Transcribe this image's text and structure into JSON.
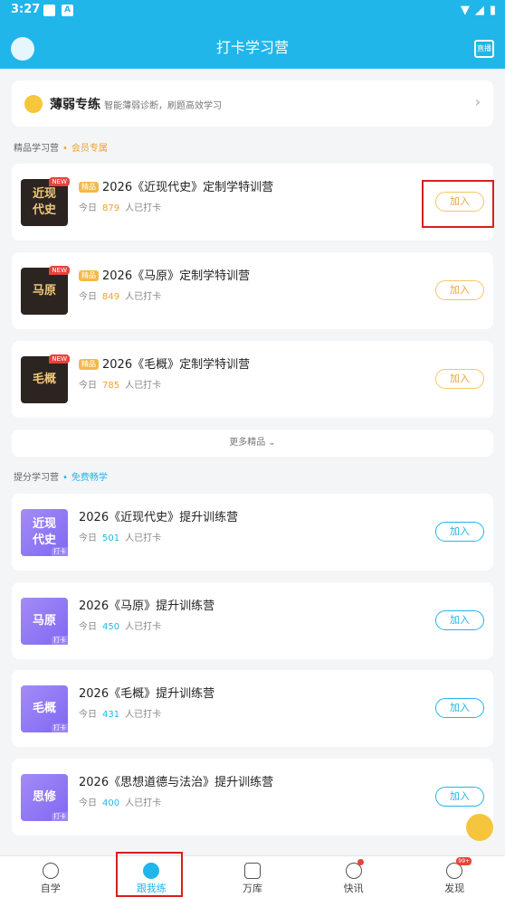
{
  "status_bar": {
    "time": "3:27"
  },
  "header": {
    "title": "打卡学习营",
    "live_label": "直播"
  },
  "weak_practice": {
    "title": "薄弱专练",
    "subtitle": "智能薄弱诊断，刷题高效学习"
  },
  "premium_section": {
    "label": "精品学习营",
    "tag": "会员专属",
    "badge": "精品",
    "new_tag": "NEW",
    "today_prefix": "今日",
    "today_suffix": "人已打卡",
    "join_label": "加入"
  },
  "premium_camps": [
    {
      "thumb": "近现代史",
      "name": "2026《近现代史》定制学特训营",
      "count": "879"
    },
    {
      "thumb": "马原",
      "name": "2026《马原》定制学特训营",
      "count": "849"
    },
    {
      "thumb": "毛概",
      "name": "2026《毛概》定制学特训营",
      "count": "785"
    }
  ],
  "more_premium": "更多精品",
  "boost_section": {
    "label": "提分学习营",
    "tag": "免费畅学",
    "thumb_tag": "打卡",
    "today_prefix": "今日",
    "today_suffix": "人已打卡",
    "join_label": "加入"
  },
  "boost_camps": [
    {
      "thumb": "近现代史",
      "name": "2026《近现代史》提升训练营",
      "count": "501"
    },
    {
      "thumb": "马原",
      "name": "2026《马原》提升训练营",
      "count": "450"
    },
    {
      "thumb": "毛概",
      "name": "2026《毛概》提升训练营",
      "count": "431"
    },
    {
      "thumb": "思修",
      "name": "2026《思想道德与法治》提升训练营",
      "count": "400"
    }
  ],
  "tabbar": {
    "tabs": [
      {
        "label": "自学",
        "active": false
      },
      {
        "label": "跟我练",
        "active": true
      },
      {
        "label": "万库",
        "active": false
      },
      {
        "label": "快讯",
        "active": false
      },
      {
        "label": "发现",
        "active": false
      }
    ],
    "discover_badge": "99+"
  },
  "colors": {
    "primary": "#20b6ea",
    "gold": "#f0a030",
    "highlight": "#d81e1e"
  }
}
